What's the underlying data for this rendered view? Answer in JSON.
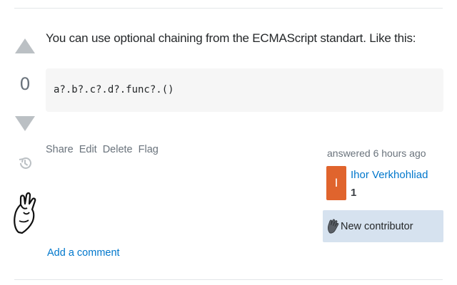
{
  "answer": {
    "vote_count": "0",
    "body_text": "You can use optional chaining from the ECMAScript standart. Like this:",
    "code": "a?.b?.c?.d?.func?.()"
  },
  "post_menu": {
    "share": "Share",
    "edit": "Edit",
    "delete": "Delete",
    "flag": "Flag"
  },
  "user_card": {
    "action_time": "answered 6 hours ago",
    "avatar_letter": "I",
    "user_name": "Ihor Verkhohliad",
    "reputation": "1",
    "new_contributor_label": "New contributor",
    "avatar_color": "#e0642d"
  },
  "comments": {
    "add_comment_label": "Add a comment"
  },
  "icons": {
    "upvote": "upvote-arrow-icon",
    "downvote": "downvote-arrow-icon",
    "history": "history-icon",
    "hand": "hand-gesture-icon",
    "wave": "wave-hand-icon"
  },
  "colors": {
    "link": "#0077cc",
    "vote_arrow": "#bbc0c4",
    "code_bg": "#f6f6f6",
    "new_contributor_bg": "#d6e2ef"
  }
}
